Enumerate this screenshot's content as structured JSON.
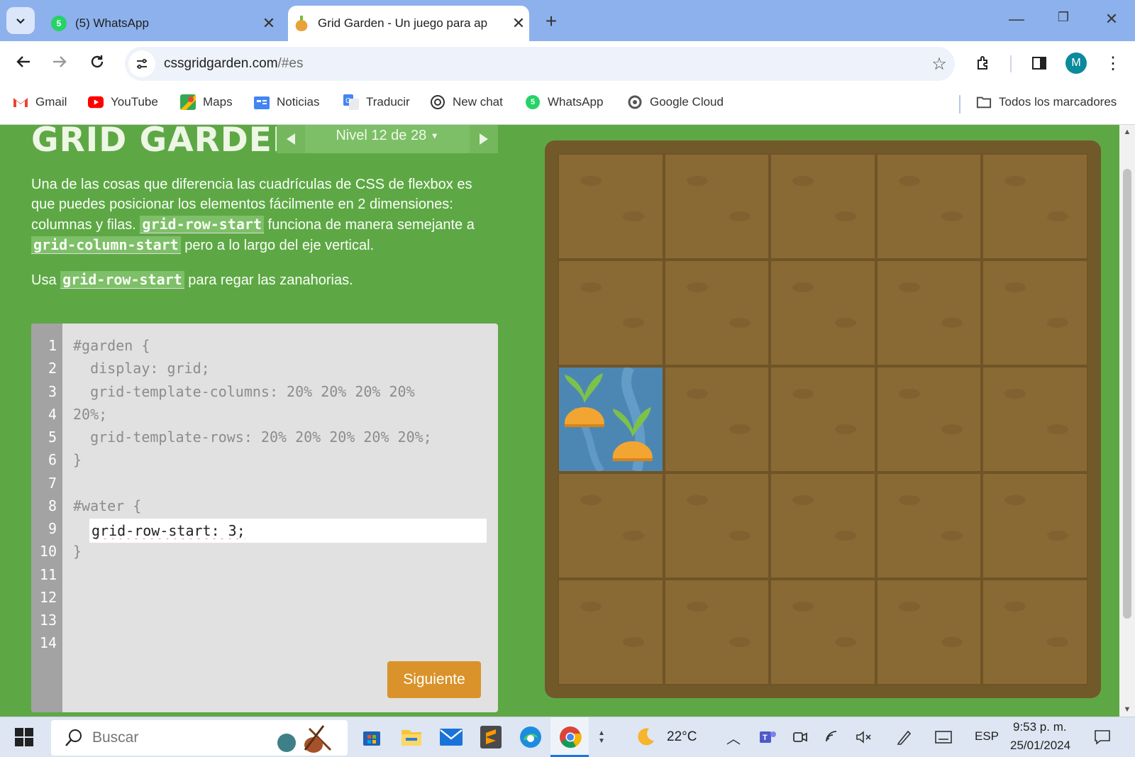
{
  "browser": {
    "tabs": [
      {
        "title": "(5) WhatsApp",
        "badge": "5",
        "active": false
      },
      {
        "title": "Grid Garden - Un juego para ap",
        "active": true
      }
    ],
    "url_host": "cssgridgarden.com",
    "url_path": "/#es",
    "profile_initial": "M",
    "bookmarks": [
      {
        "label": "Gmail",
        "icon": "gmail-icon"
      },
      {
        "label": "YouTube",
        "icon": "youtube-icon"
      },
      {
        "label": "Maps",
        "icon": "maps-icon"
      },
      {
        "label": "Noticias",
        "icon": "news-icon"
      },
      {
        "label": "Traducir",
        "icon": "translate-icon"
      },
      {
        "label": "New chat",
        "icon": "chatgpt-icon"
      },
      {
        "label": "WhatsApp",
        "icon": "whatsapp-icon",
        "badge": "5"
      },
      {
        "label": "Google Cloud",
        "icon": "google-cloud-icon"
      }
    ],
    "all_bookmarks_label": "Todos los marcadores"
  },
  "game": {
    "title": "GRID GARDEN",
    "level_label": "Nivel 12 de 28",
    "instruction_parts": {
      "p1a": "Una de las cosas que diferencia las cuadrículas de CSS de flexbox es que puedes posicionar los elementos fácilmente en 2 dimensiones: columnas y filas.",
      "p1_code1": "grid-row-start",
      "p1b": "funciona de manera semejante a",
      "p1_code2": "grid-column-start",
      "p1c": "pero a lo largo del eje vertical.",
      "p2a": "Usa",
      "p2_code": "grid-row-start",
      "p2b": "para regar las zanahorias."
    },
    "code_lines": [
      "#garden {",
      "  display: grid;",
      "  grid-template-columns: 20% 20% 20% 20%",
      "20%;",
      "  grid-template-rows: 20% 20% 20% 20% 20%;",
      "}",
      "",
      "#water {",
      "",
      "}"
    ],
    "line_numbers": [
      "1",
      "2",
      "3",
      "4",
      "5",
      "6",
      "7",
      "8",
      "9",
      "10",
      "11",
      "12",
      "13",
      "14"
    ],
    "user_input": "grid-row-start: 3;",
    "next_button": "Siguiente",
    "water_row": 3,
    "water_column": 1
  },
  "taskbar": {
    "search_placeholder": "Buscar",
    "temperature": "22°C",
    "language": "ESP",
    "time": "9:53 p. m.",
    "date": "25/01/2024"
  },
  "colors": {
    "page_bg": "#5da845",
    "soil": "#8a6a34",
    "water": "#4c87b4",
    "button": "#d9932a"
  }
}
